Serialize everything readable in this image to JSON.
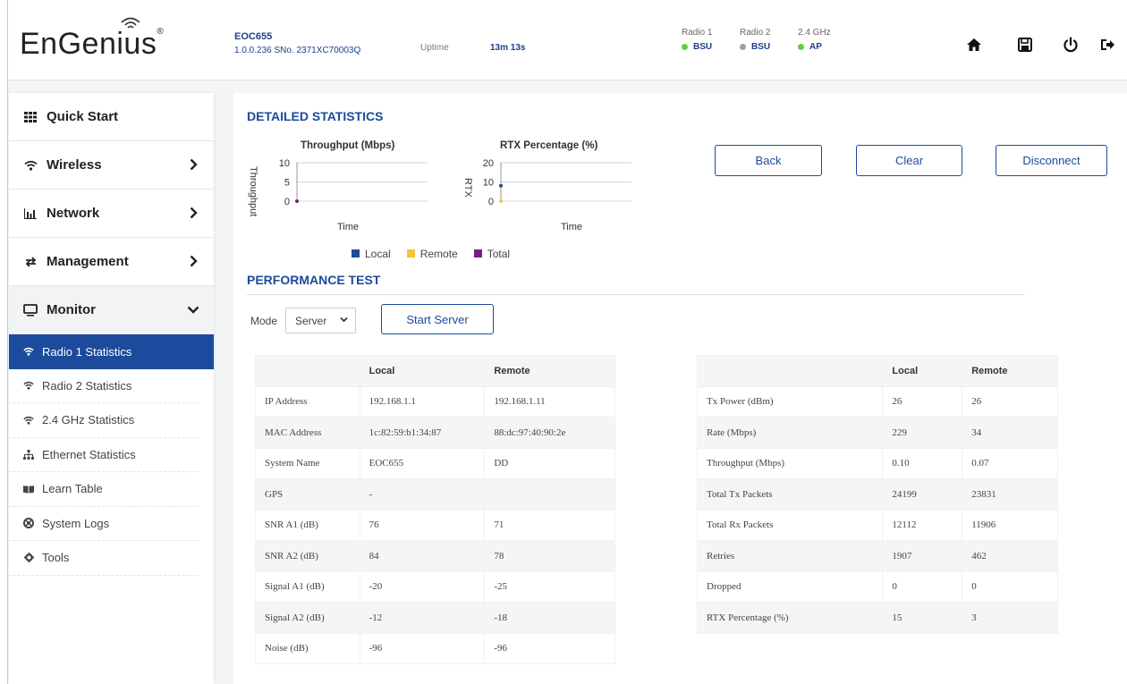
{
  "header": {
    "logo": "EnGenius",
    "model": "EOC655",
    "version": "1.0.0.236 SNo. 2371XC70003Q",
    "uptime_label": "Uptime",
    "uptime_value": "13m 13s",
    "radios": [
      {
        "name": "Radio 1",
        "status": "BSU",
        "color": "#5fd03a"
      },
      {
        "name": "Radio 2",
        "status": "BSU",
        "color": "#9aa0a6"
      },
      {
        "name": "2.4 GHz",
        "status": "AP",
        "color": "#5fd03a"
      }
    ],
    "icons": [
      "home-icon",
      "save-icon",
      "power-icon",
      "logout-icon"
    ]
  },
  "sidebar": {
    "menu": [
      {
        "label": "Quick Start",
        "icon": "grid-icon"
      },
      {
        "label": "Wireless",
        "icon": "wifi-icon"
      },
      {
        "label": "Network",
        "icon": "bar-chart-icon"
      },
      {
        "label": "Management",
        "icon": "transfer-icon"
      },
      {
        "label": "Monitor",
        "icon": "monitor-icon"
      }
    ],
    "submenu": [
      {
        "label": "Radio 1 Statistics",
        "icon": "wifi-icon",
        "active": true
      },
      {
        "label": "Radio 2 Statistics",
        "icon": "wifi-icon"
      },
      {
        "label": "2.4 GHz Statistics",
        "icon": "wifi-icon"
      },
      {
        "label": "Ethernet Statistics",
        "icon": "sitemap-icon"
      },
      {
        "label": "Learn Table",
        "icon": "book-icon"
      },
      {
        "label": "System Logs",
        "icon": "lifebuoy-icon"
      },
      {
        "label": "Tools",
        "icon": "gear-icon"
      }
    ]
  },
  "detailed": {
    "title": "DETAILED STATISTICS",
    "buttons": {
      "back": "Back",
      "clear": "Clear",
      "disconnect": "Disconnect"
    },
    "legend": [
      {
        "label": "Local",
        "color": "#1c4a9c"
      },
      {
        "label": "Remote",
        "color": "#f5c242"
      },
      {
        "label": "Total",
        "color": "#7b1f7a"
      }
    ]
  },
  "chart_data": [
    {
      "type": "line",
      "title": "Throughput (Mbps)",
      "xlabel": "Time",
      "ylabel": "Throughput",
      "yticks": [
        0,
        5,
        10
      ],
      "ylim": [
        0,
        10
      ],
      "series": [
        {
          "name": "Total",
          "x": [
            0
          ],
          "y": [
            0
          ],
          "color": "#7b1f7a"
        }
      ]
    },
    {
      "type": "line",
      "title": "RTX Percentage (%)",
      "xlabel": "Time",
      "ylabel": "RTX",
      "yticks": [
        0,
        10,
        20
      ],
      "ylim": [
        0,
        20
      ],
      "series": [
        {
          "name": "Local",
          "x": [
            0
          ],
          "y": [
            8
          ],
          "color": "#1c4a9c"
        },
        {
          "name": "Remote",
          "x": [
            0
          ],
          "y": [
            0
          ],
          "color": "#f5c242"
        }
      ]
    }
  ],
  "performance": {
    "title": "PERFORMANCE TEST",
    "mode_label": "Mode",
    "mode_value": "Server",
    "start_button": "Start Server"
  },
  "table_left": {
    "headers": [
      "",
      "Local",
      "Remote"
    ],
    "rows": [
      [
        "IP Address",
        "192.168.1.1",
        "192.168.1.11"
      ],
      [
        "MAC Address",
        "1c:82:59:b1:34:87",
        "88:dc:97:40:90:2e"
      ],
      [
        "System Name",
        "EOC655",
        "DD"
      ],
      [
        "GPS",
        "-",
        ""
      ],
      [
        "SNR A1 (dB)",
        "76",
        "71"
      ],
      [
        "SNR A2 (dB)",
        "84",
        "78"
      ],
      [
        "Signal A1 (dB)",
        "-20",
        "-25"
      ],
      [
        "Signal A2 (dB)",
        "-12",
        "-18"
      ],
      [
        "Noise (dB)",
        "-96",
        "-96"
      ]
    ]
  },
  "table_right": {
    "headers": [
      "",
      "Local",
      "Remote"
    ],
    "rows": [
      [
        "Tx Power (dBm)",
        "26",
        "26"
      ],
      [
        "Rate (Mbps)",
        "229",
        "34"
      ],
      [
        "Throughput (Mbps)",
        "0.10",
        "0.07"
      ],
      [
        "Total Tx Packets",
        "24199",
        "23831"
      ],
      [
        "Total Rx Packets",
        "12112",
        "11906"
      ],
      [
        "Retries",
        "1907",
        "462"
      ],
      [
        "Dropped",
        "0",
        "0"
      ],
      [
        "RTX Percentage (%)",
        "15",
        "3"
      ]
    ]
  }
}
